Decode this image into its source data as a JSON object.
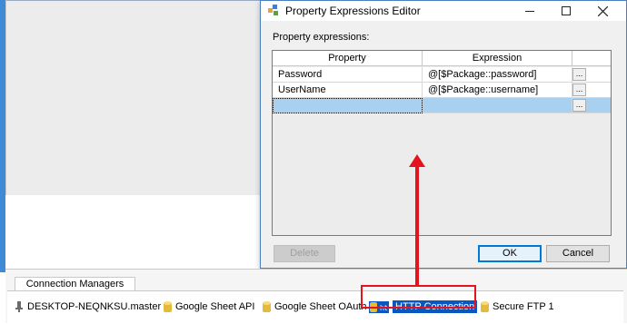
{
  "dialog": {
    "title": "Property Expressions Editor",
    "label": "Property expressions:",
    "columns": [
      "Property",
      "Expression"
    ],
    "rows": [
      {
        "property": "Password",
        "expression": "@[$Package::password]"
      },
      {
        "property": "UserName",
        "expression": "@[$Package::username]"
      },
      {
        "property": "",
        "expression": ""
      }
    ],
    "ellipsis": "...",
    "delete_label": "Delete",
    "ok_label": "OK",
    "cancel_label": "Cancel"
  },
  "connection_managers": {
    "tab_label": "Connection Managers",
    "items": [
      {
        "name": "DESKTOP-NEQNKSU.master",
        "icon": "database-connection-icon"
      },
      {
        "name": "Google Sheet API",
        "icon": "connection-cylinder-icon"
      },
      {
        "name": "Google Sheet OAuth",
        "icon": "connection-cylinder-icon"
      },
      {
        "name": "HTTP Connection",
        "icon": "http-connection-icon"
      },
      {
        "name": "Secure FTP 1",
        "icon": "connection-cylinder-icon"
      }
    ],
    "selected": "HTTP Connection"
  },
  "colors": {
    "annotation": "#e3141e",
    "selection": "#0a57c2",
    "row_selection": "#a8d0f0",
    "accent": "#0078d7"
  }
}
